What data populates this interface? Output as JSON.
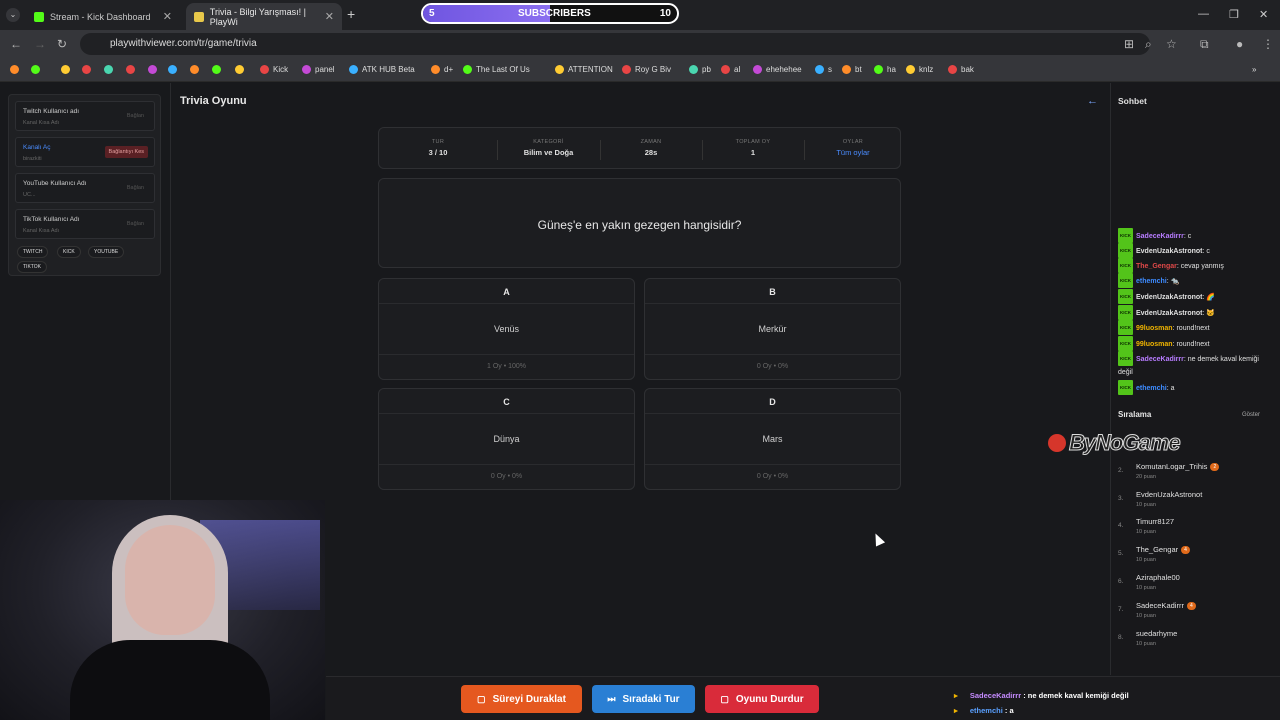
{
  "browser": {
    "tabs": [
      {
        "label": "Stream - Kick Dashboard",
        "icon_color": "#53fc18"
      },
      {
        "label": "Trivia - Bilgi Yarışması! | PlayWi",
        "icon_color": "#e8c84a"
      }
    ],
    "url": "playwithviewer.com/tr/game/trivia",
    "bookmarks": [
      "Kick",
      "panel",
      "ATK HUB Beta",
      "d+",
      "The Last Of Us",
      "ATTENTION",
      "Roy G Biv",
      "pb",
      "al",
      "ehehehee",
      "s",
      "bt",
      "ha",
      "knlz",
      "bak"
    ]
  },
  "subs_overlay": {
    "left": "5",
    "label": "SUBSCRIBERS",
    "right": "10",
    "progress": 0.5
  },
  "connections": [
    {
      "title": "Twitch Kullanıcı adı",
      "sub": "Kanal Kısa Adı",
      "action": "Bağlan"
    },
    {
      "title": "Kanalı Aç",
      "sub": "birazkiti",
      "action": "Bağlantıyı Kes"
    },
    {
      "title": "YouTube Kullanıcı Adı",
      "sub": "UC...",
      "action": "Bağlan"
    },
    {
      "title": "TikTok Kullanıcı Adı",
      "sub": "Kanal Kısa Adı",
      "action": "Bağlan"
    }
  ],
  "platform_chips": [
    "TWITCH",
    "KICK",
    "YOUTUBE",
    "TIKTOK"
  ],
  "page": {
    "title": "Trivia Oyunu"
  },
  "stats": [
    {
      "label": "TUR",
      "value": "3 / 10"
    },
    {
      "label": "KATEGORİ",
      "value": "Bilim ve Doğa"
    },
    {
      "label": "ZAMAN",
      "value": "28s"
    },
    {
      "label": "TOPLAM OY",
      "value": "1"
    },
    {
      "label": "OYLAR",
      "value": "Tüm oylar"
    }
  ],
  "question": "Güneş'e en yakın gezegen hangisidir?",
  "options": [
    {
      "key": "A",
      "answer": "Venüs",
      "votes": "1 Oy • 100%"
    },
    {
      "key": "B",
      "answer": "Merkür",
      "votes": "0 Oy • 0%"
    },
    {
      "key": "C",
      "answer": "Dünya",
      "votes": "0 Oy • 0%"
    },
    {
      "key": "D",
      "answer": "Mars",
      "votes": "0 Oy • 0%"
    }
  ],
  "controls": {
    "pause": "Süreyi Duraklat",
    "next": "Sıradaki Tur",
    "stop": "Oyunu Durdur",
    "colors": {
      "pause": "#e5581f",
      "next": "#2a7fd4",
      "stop": "#d92b3a"
    }
  },
  "chat": {
    "title": "Sohbet",
    "badge": "KICK",
    "messages": [
      {
        "user": "SadeceKadirrr",
        "color": "#b77cff",
        "text": "c"
      },
      {
        "user": "EvdenUzakAstronot",
        "color": "#e0e0e0",
        "text": "c"
      },
      {
        "user": "The_Gengar",
        "color": "#e04848",
        "text": "cevap yanmış"
      },
      {
        "user": "ethemchi",
        "color": "#3d8bff",
        "text": "🐀"
      },
      {
        "user": "EvdenUzakAstronot",
        "color": "#e0e0e0",
        "text": "🌈"
      },
      {
        "user": "EvdenUzakAstronot",
        "color": "#e0e0e0",
        "text": "🐱"
      },
      {
        "user": "99luosman",
        "color": "#f0b400",
        "text": "round!next"
      },
      {
        "user": "99luosman",
        "color": "#f0b400",
        "text": "round!next"
      },
      {
        "user": "SadeceKadirrr",
        "color": "#b77cff",
        "text": "ne demek kaval kemiği değil"
      },
      {
        "user": "ethemchi",
        "color": "#3d8bff",
        "text": "a"
      }
    ]
  },
  "ranking": {
    "title": "Sıralama",
    "show": "Göster",
    "items": [
      {
        "n": "1.",
        "name": "",
        "points": "",
        "badge": ""
      },
      {
        "n": "2.",
        "name": "KomutanLogar_Trihis",
        "points": "20 puan",
        "badge": "2"
      },
      {
        "n": "3.",
        "name": "EvdenUzakAstronot",
        "points": "10 puan",
        "badge": ""
      },
      {
        "n": "4.",
        "name": "Timurr8127",
        "points": "10 puan",
        "badge": ""
      },
      {
        "n": "5.",
        "name": "The_Gengar",
        "points": "10 puan",
        "badge": "4"
      },
      {
        "n": "6.",
        "name": "Aziraphale00",
        "points": "10 puan",
        "badge": ""
      },
      {
        "n": "7.",
        "name": "SadeceKadirrr",
        "points": "10 puan",
        "badge": "4"
      },
      {
        "n": "8.",
        "name": "suedarhyme",
        "points": "10 puan",
        "badge": ""
      }
    ]
  },
  "watermark": "ByNoGame",
  "stream_chat_overlay": [
    {
      "user": "SadeceKadirrr",
      "text": " : ne demek kaval kemiği değil",
      "color": "#c58bff"
    },
    {
      "user": "ethemchi",
      "text": " : a",
      "color": "#5aa0ff"
    }
  ]
}
